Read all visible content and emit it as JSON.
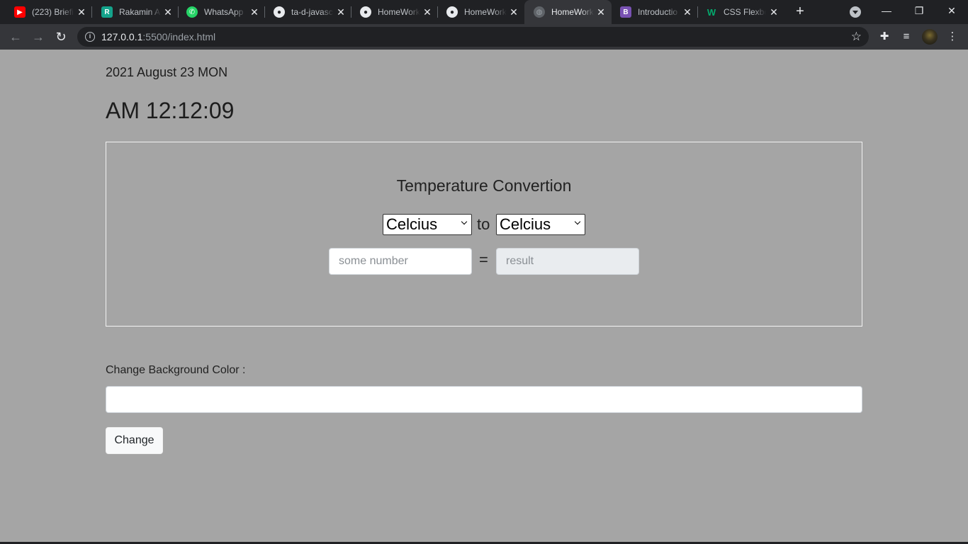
{
  "browser": {
    "tabs": [
      {
        "title": "(223) Briefi",
        "icon": "youtube-icon",
        "color": "#ff0000",
        "glyph": "▶",
        "active": false
      },
      {
        "title": "Rakamin A",
        "icon": "rakamin-icon",
        "color": "#14a38b",
        "glyph": "R",
        "active": false
      },
      {
        "title": "WhatsApp",
        "icon": "whatsapp-icon",
        "color": "#25d366",
        "glyph": "✆",
        "active": false
      },
      {
        "title": "ta-d-javasc",
        "icon": "github-icon",
        "color": "#202124",
        "glyph": "●",
        "active": false
      },
      {
        "title": "HomeWork",
        "icon": "github-icon",
        "color": "#202124",
        "glyph": "●",
        "active": false
      },
      {
        "title": "HomeWork",
        "icon": "github-icon",
        "color": "#202124",
        "glyph": "●",
        "active": false
      },
      {
        "title": "HomeWork",
        "icon": "globe-icon",
        "color": "#5f6368",
        "glyph": "◍",
        "active": true
      },
      {
        "title": "Introductio",
        "icon": "bootstrap-icon",
        "color": "#7952b3",
        "glyph": "B",
        "active": false
      },
      {
        "title": "CSS Flexbo",
        "icon": "w3schools-icon",
        "color": "#04aa6d",
        "glyph": "W",
        "active": false
      }
    ],
    "url_host": "127.0.0.1",
    "url_rest": ":5500/index.html",
    "window_controls": {
      "minimize": "—",
      "restore": "❐",
      "close": "✕"
    }
  },
  "page": {
    "date": "2021 August 23 MON",
    "time": "AM 12:12:09",
    "converter": {
      "title": "Temperature Convertion",
      "from_unit": "Celcius",
      "to_word": "to",
      "to_unit": "Celcius",
      "input_placeholder": "some number",
      "equals": "=",
      "result_placeholder": "result"
    },
    "bg_color": {
      "label": "Change Background Color :",
      "input_value": "",
      "button_label": "Change"
    }
  }
}
